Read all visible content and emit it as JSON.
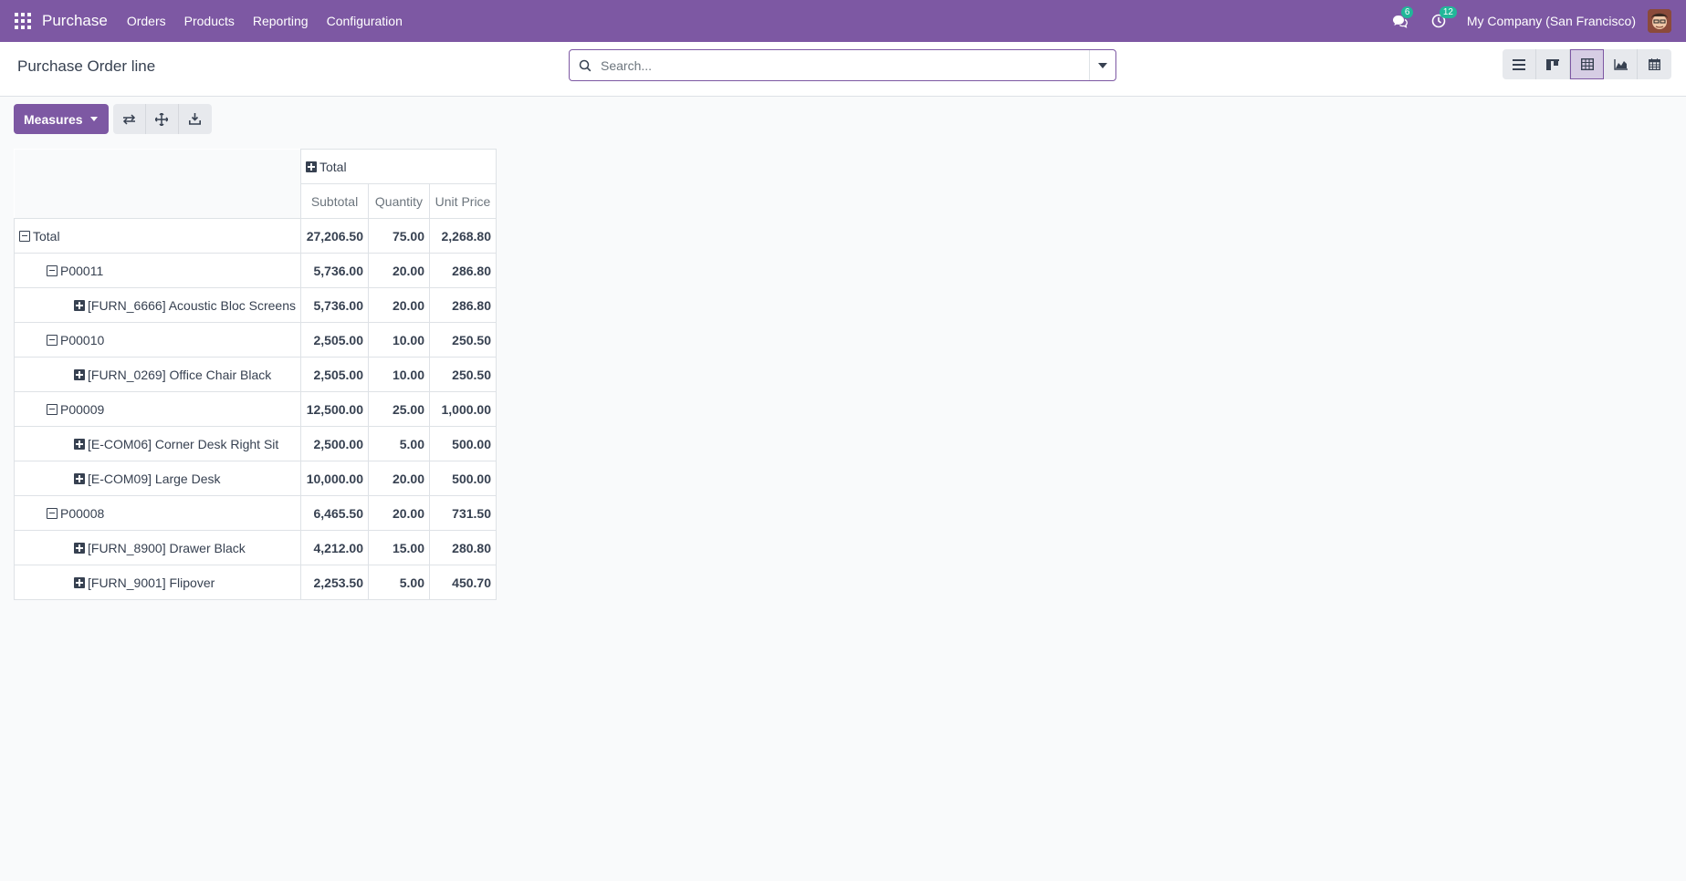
{
  "navbar": {
    "app_name": "Purchase",
    "menu": [
      "Orders",
      "Products",
      "Reporting",
      "Configuration"
    ],
    "messages_count": "6",
    "activities_count": "12",
    "company": "My Company (San Francisco)",
    "icons": [
      "apps-icon",
      "chat-icon",
      "clock-icon",
      "avatar"
    ]
  },
  "control_panel": {
    "title": "Purchase Order line",
    "search_placeholder": "Search...",
    "views": [
      "list",
      "kanban",
      "pivot",
      "graph",
      "calendar"
    ],
    "active_view": "pivot"
  },
  "toolbar": {
    "measures_label": "Measures",
    "tools": [
      "flip-axis-icon",
      "expand-all-icon",
      "download-icon"
    ]
  },
  "pivot": {
    "column_header": "Total",
    "measures": [
      "Subtotal",
      "Quantity",
      "Unit Price"
    ],
    "rows": [
      {
        "label": "Total",
        "level": 0,
        "state": "expanded",
        "values": [
          "27,206.50",
          "75.00",
          "2,268.80"
        ]
      },
      {
        "label": "P00011",
        "level": 1,
        "state": "expanded",
        "values": [
          "5,736.00",
          "20.00",
          "286.80"
        ]
      },
      {
        "label": "[FURN_6666] Acoustic Bloc Screens",
        "level": 2,
        "state": "collapsed",
        "values": [
          "5,736.00",
          "20.00",
          "286.80"
        ]
      },
      {
        "label": "P00010",
        "level": 1,
        "state": "expanded",
        "values": [
          "2,505.00",
          "10.00",
          "250.50"
        ]
      },
      {
        "label": "[FURN_0269] Office Chair Black",
        "level": 2,
        "state": "collapsed",
        "values": [
          "2,505.00",
          "10.00",
          "250.50"
        ]
      },
      {
        "label": "P00009",
        "level": 1,
        "state": "expanded",
        "values": [
          "12,500.00",
          "25.00",
          "1,000.00"
        ]
      },
      {
        "label": "[E-COM06] Corner Desk Right Sit",
        "level": 2,
        "state": "collapsed",
        "values": [
          "2,500.00",
          "5.00",
          "500.00"
        ]
      },
      {
        "label": "[E-COM09] Large Desk",
        "level": 2,
        "state": "collapsed",
        "values": [
          "10,000.00",
          "20.00",
          "500.00"
        ]
      },
      {
        "label": "P00008",
        "level": 1,
        "state": "expanded",
        "values": [
          "6,465.50",
          "20.00",
          "731.50"
        ]
      },
      {
        "label": "[FURN_8900] Drawer Black",
        "level": 2,
        "state": "collapsed",
        "values": [
          "4,212.00",
          "15.00",
          "280.80"
        ]
      },
      {
        "label": "[FURN_9001] Flipover",
        "level": 2,
        "state": "collapsed",
        "values": [
          "2,253.50",
          "5.00",
          "450.70"
        ]
      }
    ]
  },
  "colors": {
    "brand": "#7d58a3",
    "badge": "#21b799",
    "background": "#f9fafb"
  }
}
